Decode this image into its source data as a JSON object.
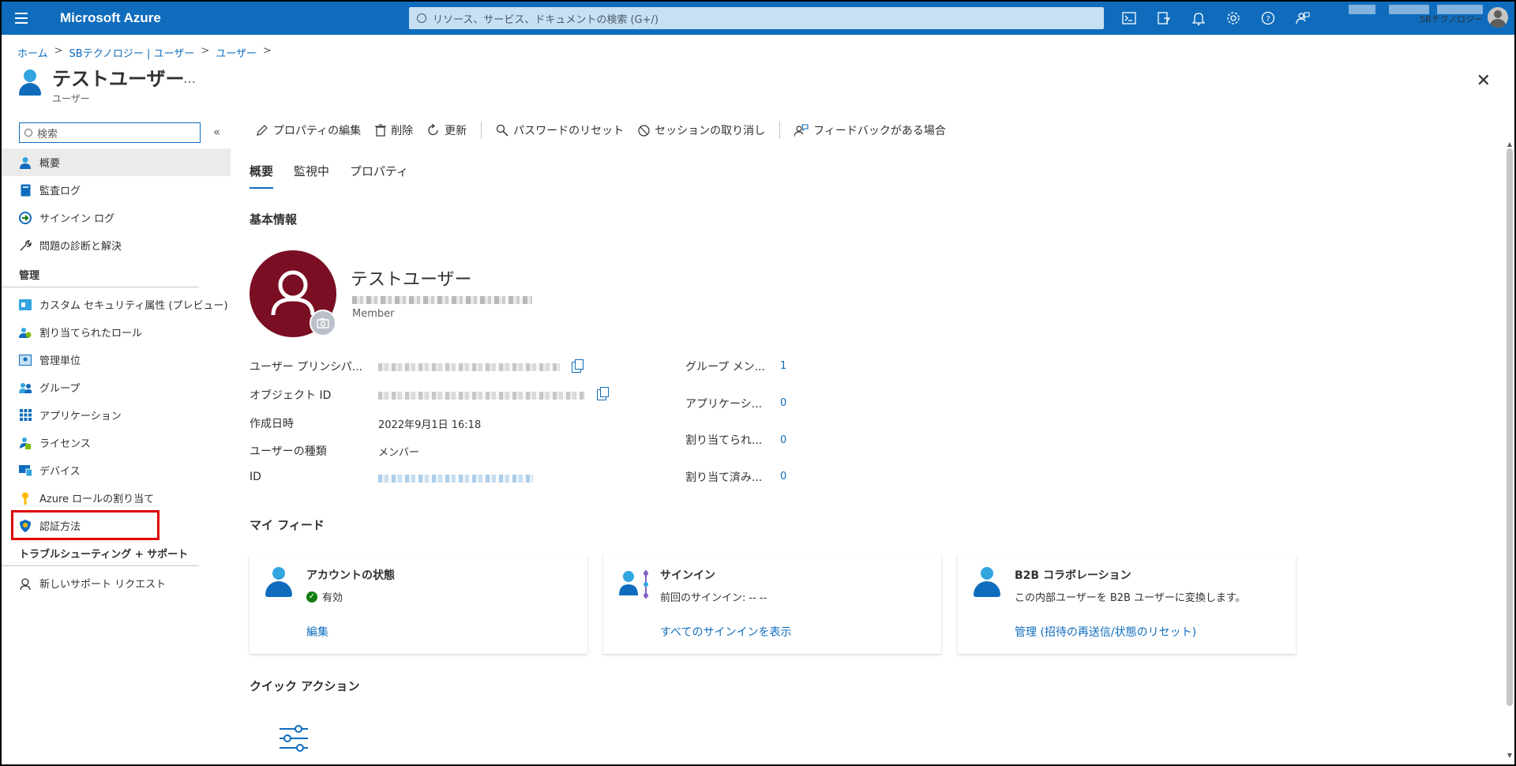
{
  "topbar": {
    "brand": "Microsoft Azure",
    "search_placeholder": "リソース、サービス、ドキュメントの検索 (G+/)",
    "org": "SBテクノロジー"
  },
  "breadcrumb": [
    "ホーム",
    "SBテクノロジー | ユーザー",
    "ユーザー"
  ],
  "header": {
    "title": "テストユーザー",
    "subtitle": "ユーザー",
    "more": "…",
    "close": "✕"
  },
  "sidebar": {
    "search_placeholder": "検索",
    "collapse": "«",
    "items": [
      {
        "label": "概要",
        "icon": "user-icon",
        "active": true
      },
      {
        "label": "監査ログ",
        "icon": "audit-log-icon"
      },
      {
        "label": "サインイン ログ",
        "icon": "sign-in-log-icon"
      },
      {
        "label": "問題の診断と解決",
        "icon": "wrench-icon"
      }
    ],
    "section_manage": "管理",
    "manage_items": [
      {
        "label": "カスタム セキュリティ属性 (プレビュー)",
        "icon": "custom-attr-icon"
      },
      {
        "label": "割り当てられたロール",
        "icon": "roles-icon"
      },
      {
        "label": "管理単位",
        "icon": "admin-unit-icon"
      },
      {
        "label": "グループ",
        "icon": "group-icon"
      },
      {
        "label": "アプリケーション",
        "icon": "apps-grid-icon"
      },
      {
        "label": "ライセンス",
        "icon": "license-icon"
      },
      {
        "label": "デバイス",
        "icon": "device-icon"
      },
      {
        "label": "Azure ロールの割り当て",
        "icon": "key-icon"
      },
      {
        "label": "認証方法",
        "icon": "shield-icon"
      }
    ],
    "section_support": "トラブルシューティング + サポート",
    "support_items": [
      {
        "label": "新しいサポート リクエスト",
        "icon": "support-person-icon"
      }
    ]
  },
  "toolbar": {
    "edit": "プロパティの編集",
    "delete": "削除",
    "refresh": "更新",
    "reset_password": "パスワードのリセット",
    "revoke_sessions": "セッションの取り消し",
    "feedback": "フィードバックがある場合"
  },
  "tabs": [
    "概要",
    "監視中",
    "プロパティ"
  ],
  "basic": {
    "heading": "基本情報",
    "name": "テストユーザー",
    "type_label": "Member",
    "fields": [
      {
        "label": "ユーザー プリンシパ..."
      },
      {
        "label": "オブジェクト ID"
      },
      {
        "label": "作成日時",
        "value": "2022年9月1日 16:18"
      },
      {
        "label": "ユーザーの種類",
        "value": "メンバー"
      },
      {
        "label": "ID"
      }
    ],
    "counts": [
      {
        "label": "グループ メン...",
        "value": "1"
      },
      {
        "label": "アプリケーシ...",
        "value": "0"
      },
      {
        "label": "割り当てられ...",
        "value": "0"
      },
      {
        "label": "割り当て済み...",
        "value": "0"
      }
    ]
  },
  "feed": {
    "heading": "マイ フィード",
    "cards": [
      {
        "title": "アカウントの状態",
        "desc": "有効",
        "link": "編集"
      },
      {
        "title": "サインイン",
        "desc": "前回のサインイン: -- --",
        "link": "すべてのサインインを表示"
      },
      {
        "title": "B2B コラボレーション",
        "desc": "この内部ユーザーを B2B ユーザーに変換します。",
        "link": "管理 (招待の再送信/状態のリセット)"
      }
    ]
  },
  "quick": {
    "heading": "クイック アクション"
  },
  "colors": {
    "azure_blue": "#0f6cbd",
    "avatar_bg": "#7a0e22",
    "highlight": "#dd0000",
    "success": "#107c10"
  }
}
